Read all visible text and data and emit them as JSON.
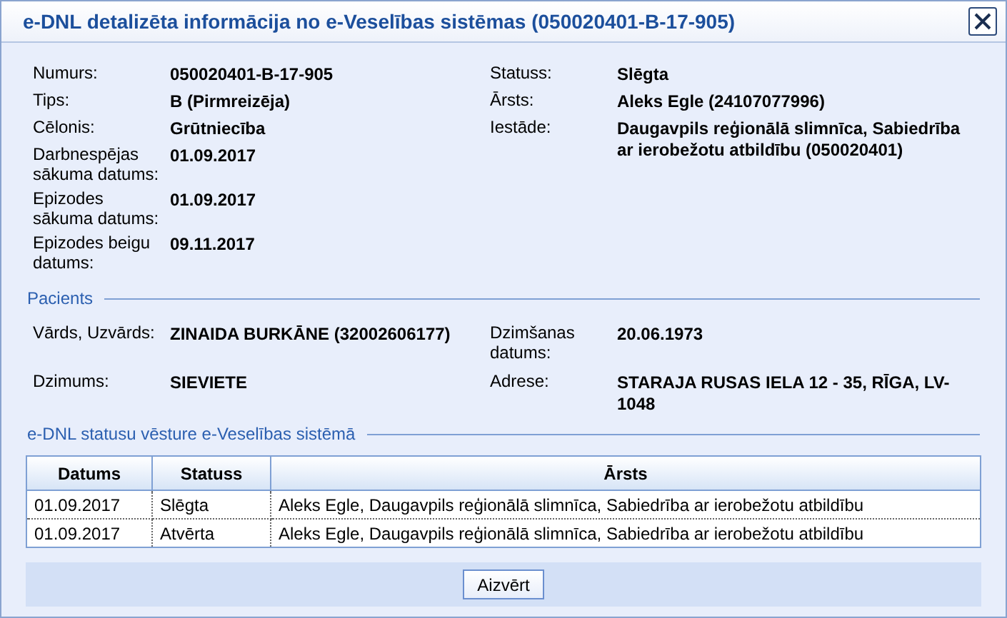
{
  "window": {
    "title": "e-DNL detalizēta informācija no e-Veselības sistēmas (050020401-B-17-905)"
  },
  "details": {
    "left": [
      {
        "label": "Numurs:",
        "value": "050020401-B-17-905"
      },
      {
        "label": "Tips:",
        "value": "B (Pirmreizēja)"
      },
      {
        "label": "Cēlonis:",
        "value": "Grūtniecība"
      },
      {
        "label": "Darbnespējas sākuma datums:",
        "value": "01.09.2017"
      },
      {
        "label": "Epizodes sākuma datums:",
        "value": "01.09.2017"
      },
      {
        "label": "Epizodes beigu datums:",
        "value": "09.11.2017"
      }
    ],
    "right": [
      {
        "label": "Statuss:",
        "value": "Slēgta"
      },
      {
        "label": "Ārsts:",
        "value": "Aleks Egle (24107077996)"
      },
      {
        "label": "Iestāde:",
        "value": "Daugavpils reģionālā slimnīca, Sabiedrība ar ierobežotu atbildību (050020401)"
      }
    ]
  },
  "patient": {
    "legend": "Pacients",
    "rows": [
      [
        {
          "label": "Vārds, Uzvārds:",
          "value": "ZINAIDA BURKĀNE (32002606177)"
        },
        {
          "label": "Dzimšanas datums:",
          "value": "20.06.1973"
        }
      ],
      [
        {
          "label": "Dzimums:",
          "value": "SIEVIETE"
        },
        {
          "label": "Adrese:",
          "value": "STARAJA RUSAS IELA 12 - 35, RĪGA, LV-1048"
        }
      ]
    ]
  },
  "history": {
    "legend": "e-DNL statusu vēsture e-Veselības sistēmā",
    "columns": [
      "Datums",
      "Statuss",
      "Ārsts"
    ],
    "rows": [
      [
        "01.09.2017",
        "Slēgta",
        "Aleks Egle, Daugavpils reģionālā slimnīca, Sabiedrība ar ierobežotu atbildību"
      ],
      [
        "01.09.2017",
        "Atvērta",
        "Aleks Egle, Daugavpils reģionālā slimnīca, Sabiedrība ar ierobežotu atbildību"
      ]
    ]
  },
  "buttons": [
    "Aizvērt"
  ]
}
